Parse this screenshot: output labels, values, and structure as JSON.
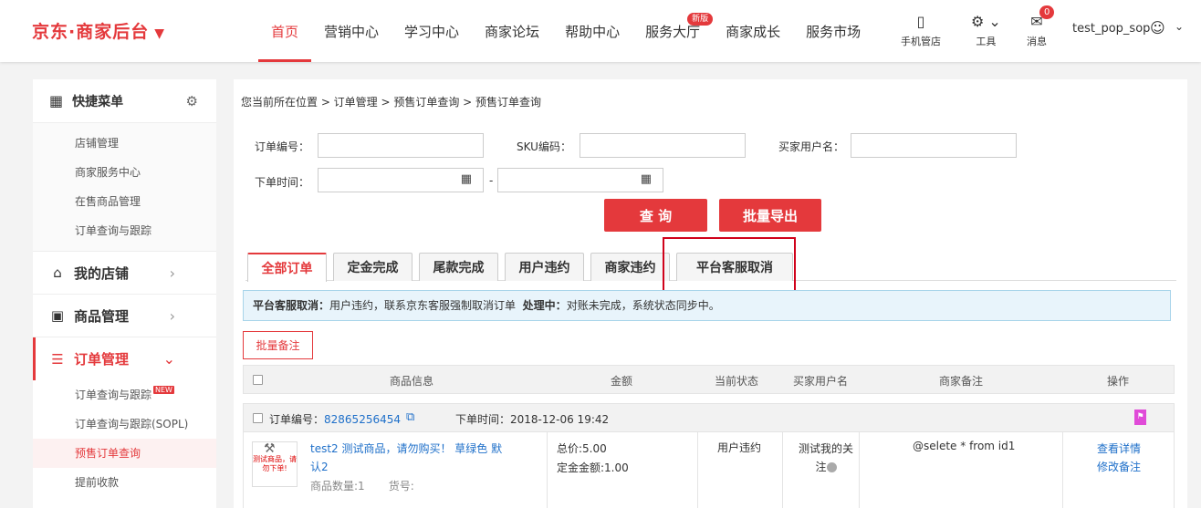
{
  "header": {
    "brand": "京东·商家后台",
    "brand_caret": "▼",
    "nav": [
      "首页",
      "营销中心",
      "学习中心",
      "商家论坛",
      "帮助中心",
      "服务大厅",
      "商家成长",
      "服务市场"
    ],
    "nav_badge": "新版",
    "tools": {
      "mobile": "手机管店",
      "tools": "工具",
      "messages": "消息",
      "message_count": "0"
    },
    "username": "test_pop_sop"
  },
  "sidebar": {
    "quick_title": "快捷菜单",
    "quick_items": [
      "店铺管理",
      "商家服务中心",
      "在售商品管理",
      "订单查询与跟踪"
    ],
    "menus": {
      "store": "我的店铺",
      "goods": "商品管理",
      "orders": "订单管理"
    },
    "order_sub": [
      "订单查询与跟踪",
      "订单查询与跟踪(SOPL)",
      "预售订单查询",
      "提前收款"
    ],
    "new_tag": "NEW"
  },
  "main": {
    "breadcrumb": "您当前所在位置 > 订单管理 > 预售订单查询 > 预售订单查询",
    "form": {
      "order_no_label": "订单编号：",
      "sku_label": "SKU编码：",
      "buyer_label": "买家用户名：",
      "time_label": "下单时间：",
      "dash": "-"
    },
    "buttons": {
      "query": "查 询",
      "export": "批量导出",
      "batch_remark": "批量备注"
    },
    "tabs": [
      "全部订单",
      "定金完成",
      "尾款完成",
      "用户违约",
      "商家违约",
      "平台客服取消"
    ],
    "notice": {
      "label1": "平台客服取消：",
      "text1": "用户违约，联系京东客服强制取消订单",
      "label2": "处理中：",
      "text2": "对账未完成，系统状态同步中。"
    },
    "table_headers": [
      "商品信息",
      "金额",
      "当前状态",
      "买家用户名",
      "商家备注",
      "操作"
    ],
    "order": {
      "no_label": "订单编号：",
      "no": "82865256454",
      "time": "下单时间：2018-12-06 19:42",
      "product_name": "test2 测试商品，请勿购买！ 草绿色 默认2",
      "thumb_text": "测试商品，请勿下单!",
      "qty": "商品数量:1",
      "sku_no": "货号:",
      "total": "总价:5.00",
      "deposit": "定金金额:1.00",
      "status": "用户违约",
      "buyer": "测试我的关注",
      "remark": "@selete * from id1",
      "op_detail": "查看详情",
      "op_remark": "修改备注"
    }
  },
  "colors": {
    "accent": "#e4393c",
    "link": "#1e6fc9",
    "highlight_border": "#d0021b",
    "notice_bg": "#e8f4fb"
  }
}
